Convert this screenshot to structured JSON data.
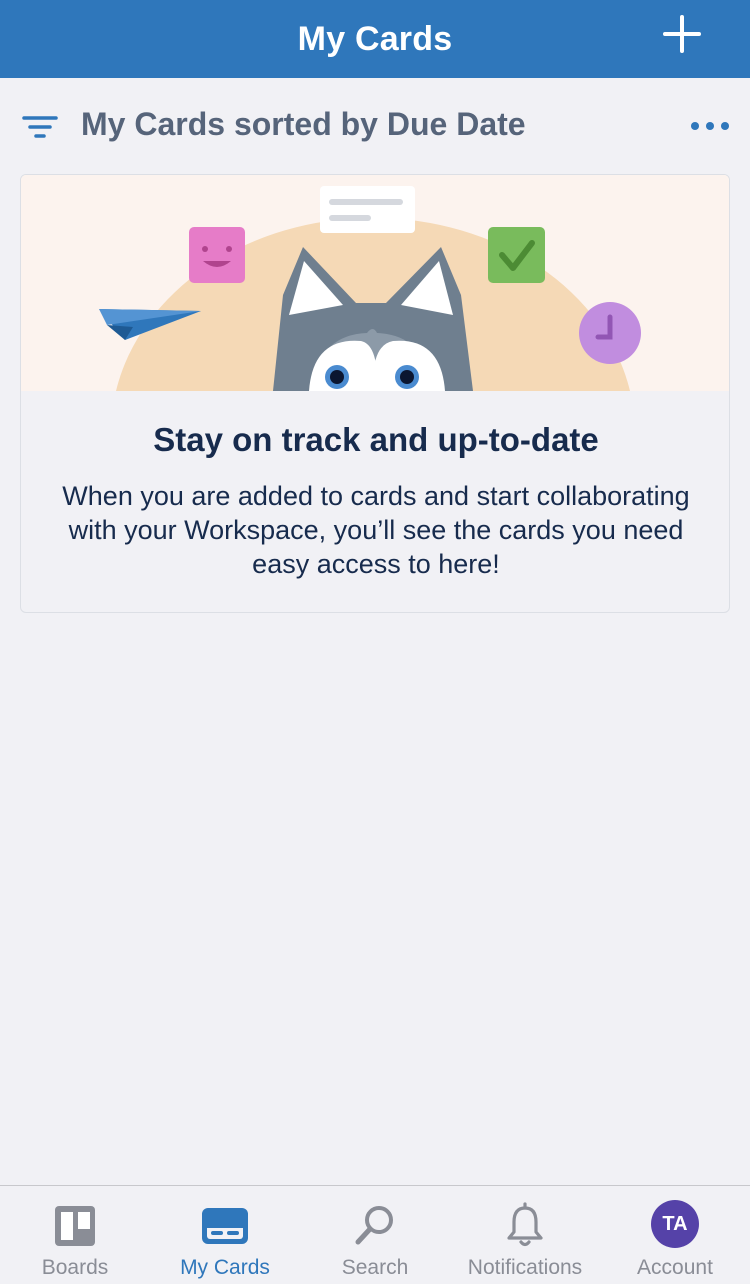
{
  "header": {
    "title": "My Cards",
    "add_icon": "plus-icon",
    "background_color": "#2f77bb"
  },
  "subheader": {
    "filter_icon": "filter-icon",
    "sort_label": "My Cards sorted by Due Date",
    "more_icon": "more-horizontal-icon"
  },
  "empty_state": {
    "illustration": "husky-peeking-illustration",
    "title": "Stay on track and up-to-date",
    "body": "When you are added to cards and start collaborating with your Workspace, you’ll see the cards you need easy access to here!"
  },
  "tabbar": {
    "tabs": [
      {
        "label": "Boards",
        "icon": "boards-icon",
        "active": false
      },
      {
        "label": "My Cards",
        "icon": "my-cards-icon",
        "active": true
      },
      {
        "label": "Search",
        "icon": "search-icon",
        "active": false
      },
      {
        "label": "Notifications",
        "icon": "bell-icon",
        "active": false
      },
      {
        "label": "Account",
        "avatar_initials": "TA",
        "active": false
      }
    ],
    "active_color": "#2f77bb",
    "inactive_color": "#8a8d96",
    "avatar_color": "#5542a8"
  }
}
